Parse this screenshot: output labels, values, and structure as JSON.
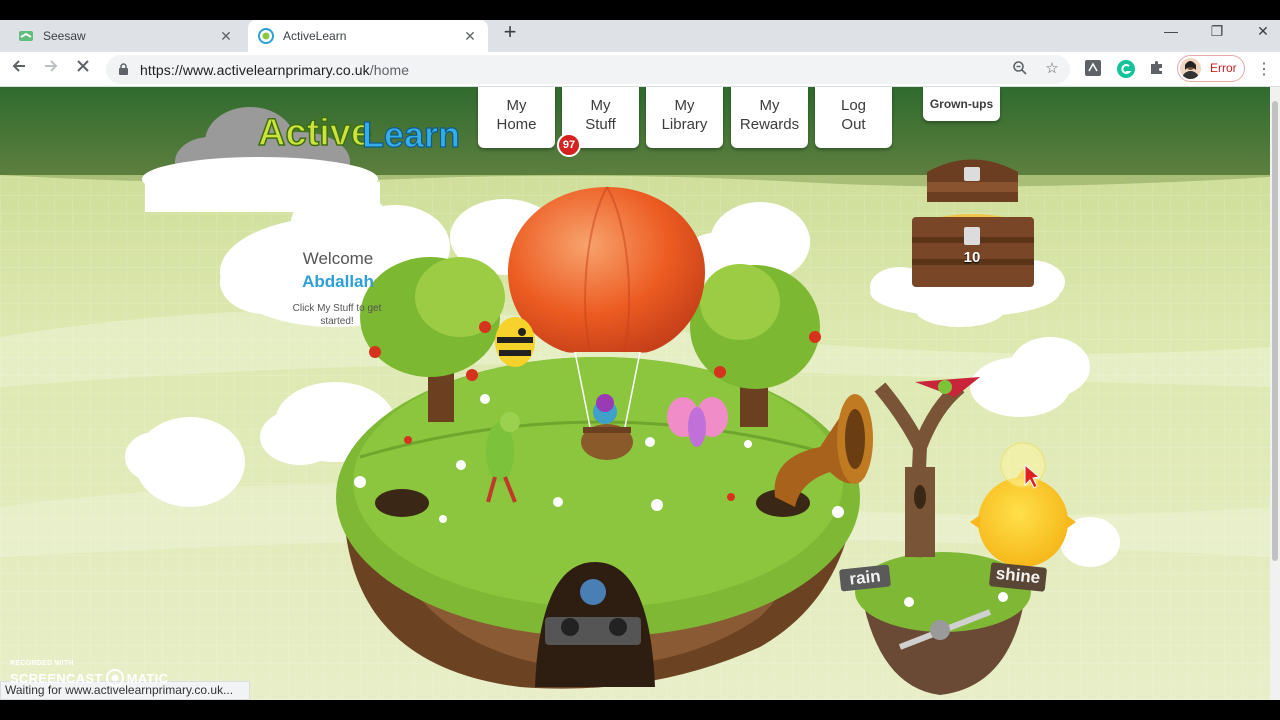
{
  "browser": {
    "tabs": [
      {
        "title": "Seesaw",
        "icon": "seesaw-icon",
        "active": false
      },
      {
        "title": "ActiveLearn",
        "icon": "activelearn-icon",
        "active": true
      }
    ],
    "new_tab_label": "+",
    "url_host": "https://www.activelearnprimary.co.uk",
    "url_path": "/home",
    "profile_label": "Error",
    "status_text": "Waiting for www.activelearnprimary.co.uk..."
  },
  "site": {
    "logo_text": "ActiveLearn",
    "nav": [
      {
        "line1": "My",
        "line2": "Home"
      },
      {
        "line1": "My",
        "line2": "Stuff"
      },
      {
        "line1": "My",
        "line2": "Library"
      },
      {
        "line1": "My",
        "line2": "Rewards"
      },
      {
        "line1": "Log",
        "line2": "Out"
      }
    ],
    "grown_ups_label": "Grown-ups",
    "stuff_badge_count": "97",
    "welcome": {
      "greeting": "Welcome",
      "name": "Abdallah",
      "hint": "Click My Stuff to get started!"
    },
    "coins_count": "10",
    "weather_signs": {
      "rain": "rain",
      "shine": "shine"
    }
  },
  "watermark": {
    "line1": "RECORDED WITH",
    "line2a": "SCREENCAST",
    "line2b": "MATIC"
  },
  "colors": {
    "sky_top": "#2f6b2e",
    "sky": "#d8e6a8",
    "grass": "#6fae2c",
    "balloon": "#ea5a1e",
    "brand_blue": "#2d9fd8",
    "badge_red": "#d3221f"
  }
}
